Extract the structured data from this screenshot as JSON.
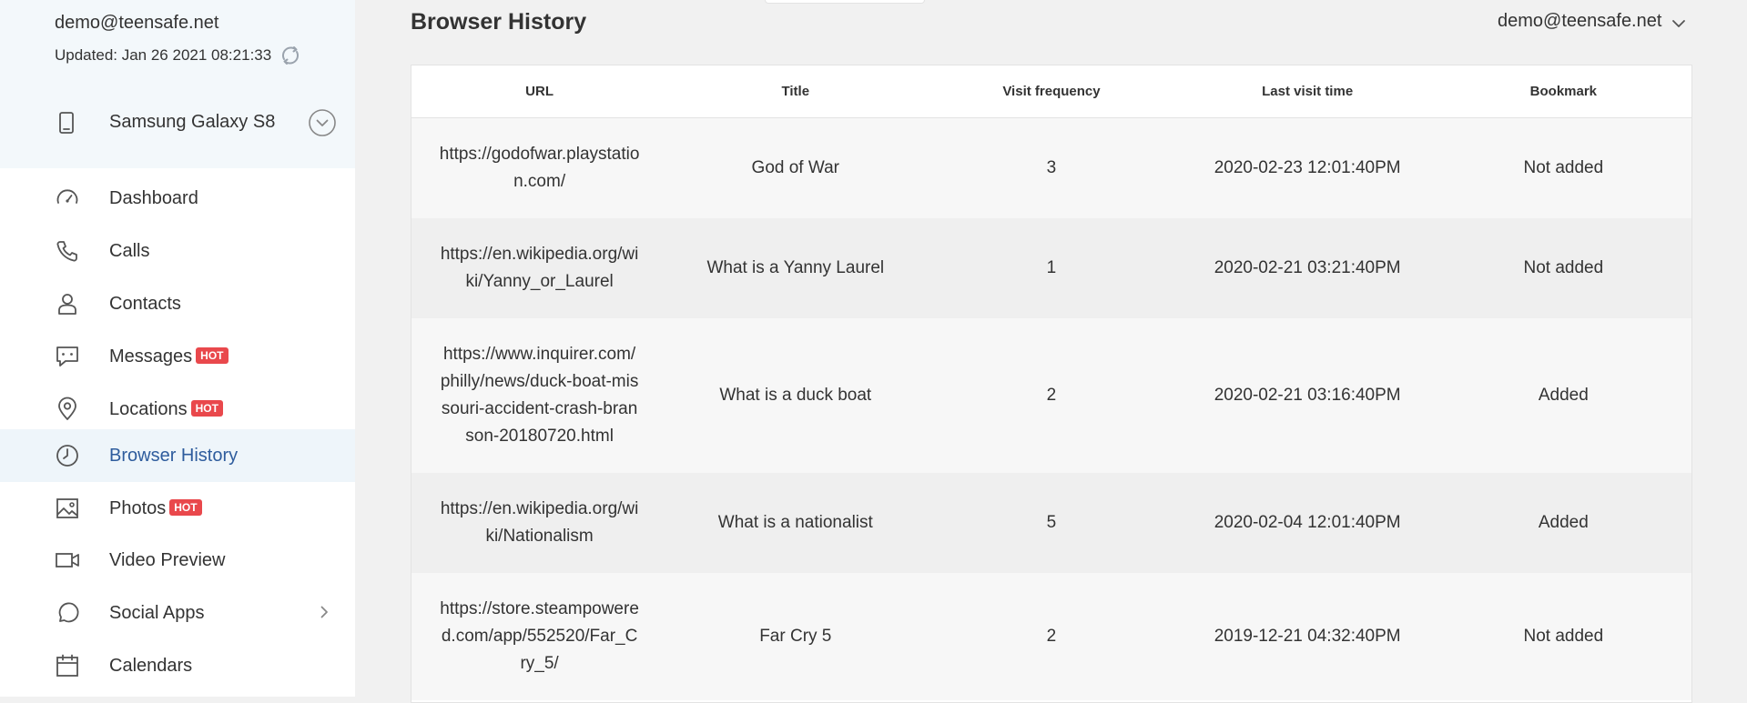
{
  "account": {
    "email": "demo@teensafe.net",
    "updated": "Updated: Jan 26 2021 08:21:33"
  },
  "device": {
    "name": "Samsung Galaxy S8"
  },
  "nav": {
    "items": [
      {
        "label": "Dashboard",
        "icon": "dashboard-icon"
      },
      {
        "label": "Calls",
        "icon": "phone-icon"
      },
      {
        "label": "Contacts",
        "icon": "user-icon"
      },
      {
        "label": "Messages",
        "icon": "message-icon",
        "badge": "HOT"
      },
      {
        "label": "Locations",
        "icon": "location-pin-icon",
        "badge": "HOT"
      },
      {
        "label": "Browser History",
        "icon": "clock-icon",
        "active": true
      },
      {
        "label": "Photos",
        "icon": "image-icon",
        "badge": "HOT"
      },
      {
        "label": "Video Preview",
        "icon": "video-camera-icon"
      },
      {
        "label": "Social Apps",
        "icon": "chat-bubble-icon"
      },
      {
        "label": "Calendars",
        "icon": "calendar-icon"
      }
    ]
  },
  "header": {
    "title": "Browser History",
    "user_email": "demo@teensafe.net"
  },
  "table": {
    "columns": [
      "URL",
      "Title",
      "Visit frequency",
      "Last visit time",
      "Bookmark"
    ],
    "rows": [
      {
        "url": "https://godofwar.playstation.com/",
        "title": "God of War",
        "frequency": "3",
        "last_visit": "2020-02-23 12:01:40PM",
        "bookmark": "Not added"
      },
      {
        "url": "https://en.wikipedia.org/wiki/Yanny_or_Laurel",
        "title": "What is a Yanny Laurel",
        "frequency": "1",
        "last_visit": "2020-02-21 03:21:40PM",
        "bookmark": "Not added"
      },
      {
        "url": "https://www.inquirer.com/philly/news/duck-boat-missouri-accident-crash-branson-20180720.html",
        "title": "What is a duck boat",
        "frequency": "2",
        "last_visit": "2020-02-21 03:16:40PM",
        "bookmark": "Added"
      },
      {
        "url": "https://en.wikipedia.org/wiki/Nationalism",
        "title": "What is a nationalist",
        "frequency": "5",
        "last_visit": "2020-02-04 12:01:40PM",
        "bookmark": "Added"
      },
      {
        "url": "https://store.steampowered.com/app/552520/Far_Cry_5/",
        "title": "Far Cry 5",
        "frequency": "2",
        "last_visit": "2019-12-21 04:32:40PM",
        "bookmark": "Not added"
      }
    ]
  },
  "colors": {
    "active_nav_text": "#2e5c9d",
    "active_nav_bg": "#eef5fa",
    "hot_badge": "#e9484c",
    "sidebar_head_bg": "#f3f8fb"
  }
}
